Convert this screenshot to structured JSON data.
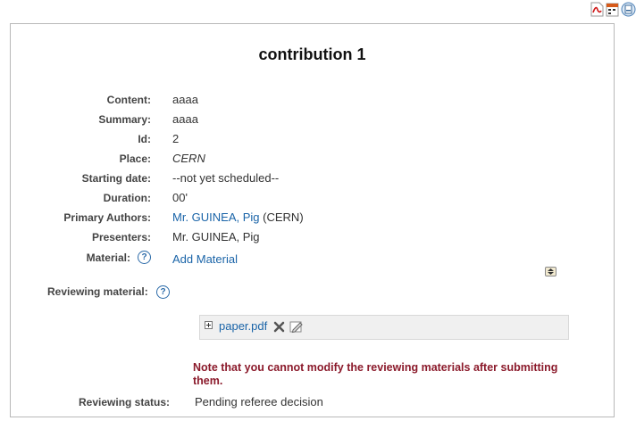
{
  "page": {
    "title": "contribution 1"
  },
  "top_icons": [
    "pdf-icon",
    "ical-icon",
    "print-icon"
  ],
  "fields": {
    "content": {
      "label": "Content:",
      "value": "aaaa"
    },
    "summary": {
      "label": "Summary:",
      "value": "aaaa"
    },
    "id": {
      "label": "Id:",
      "value": "2"
    },
    "place": {
      "label": "Place:",
      "value": "CERN"
    },
    "starting_date": {
      "label": "Starting date:",
      "value": "--not yet scheduled--"
    },
    "duration": {
      "label": "Duration:",
      "value": "00'"
    },
    "primary_authors": {
      "label": "Primary Authors:",
      "author_link": "Mr. GUINEA, Pig",
      "affiliation": "(CERN)"
    },
    "presenters": {
      "label": "Presenters:",
      "value": "Mr. GUINEA, Pig"
    },
    "material": {
      "label": "Material:",
      "help": "?",
      "link": "Add Material"
    }
  },
  "reviewing": {
    "label": "Reviewing material:",
    "help": "?",
    "file": "paper.pdf",
    "note": "Note that you cannot modify the reviewing materials after submitting them.",
    "status_label": "Reviewing status:",
    "status_value": "Pending referee decision"
  },
  "colors": {
    "link": "#1a64a8",
    "note": "#8b1a2b",
    "border": "#b8b8b8"
  }
}
